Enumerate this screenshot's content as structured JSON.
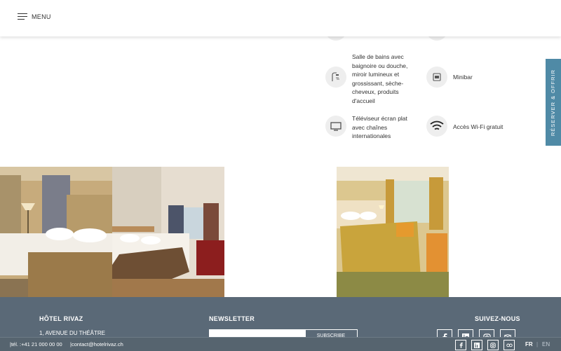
{
  "header": {
    "menu_label": "MENU"
  },
  "amenities": [
    {
      "icon": "shower-icon",
      "text": "Salle de bains avec baignoire ou douche, miroir lumineux et grossissant, sèche-cheveux, produits d'accueil"
    },
    {
      "icon": "minibar-icon",
      "text": "Minibar"
    },
    {
      "icon": "tv-icon",
      "text": "Téléviseur écran plat avec chaînes internationales"
    },
    {
      "icon": "wifi-icon",
      "text": "Accès Wi-Fi gratuit"
    }
  ],
  "side_tab": {
    "label": "RÉSERVER & OFFRIR"
  },
  "footer": {
    "hotel_heading": "HÔTEL RIVAZ",
    "address": "1, AVENUE DU THÉÂTRE",
    "newsletter_heading": "NEWSLETTER",
    "newsletter_button": "SUBSCRIBE",
    "follow_heading": "SUIVEZ-NOUS"
  },
  "bottom_bar": {
    "phone": "|tél. :+41 21 000 00 00",
    "email": "|contact@hotelrivaz.ch",
    "lang_active": "FR",
    "lang_separator": "|",
    "lang_other": "EN"
  },
  "colors": {
    "accent": "#4f8aa6",
    "footer": "#5a6977",
    "icon_bg": "#eeeeee"
  }
}
